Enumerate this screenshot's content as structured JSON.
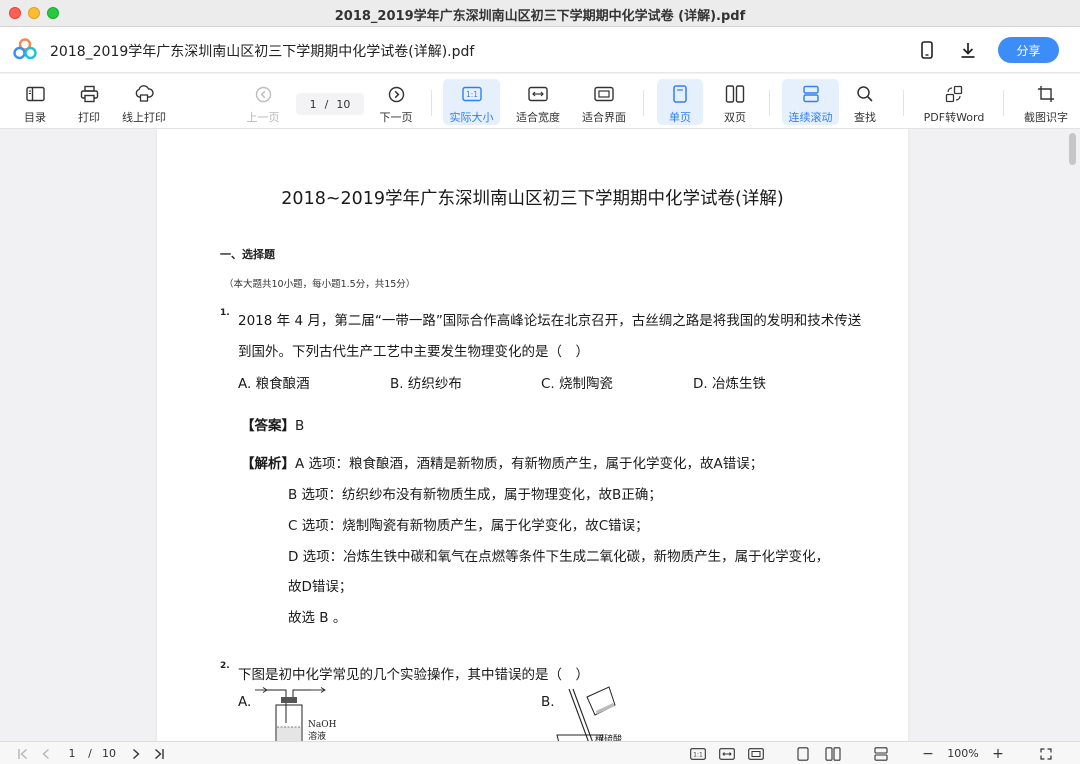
{
  "window": {
    "title": "2018_2019学年广东深圳南山区初三下学期期中化学试卷 (详解).pdf"
  },
  "header": {
    "doc_title": "2018_2019学年广东深圳南山区初三下学期期中化学试卷(详解).pdf",
    "share_label": "分享",
    "icons": [
      "app-logo-icon",
      "phone-icon",
      "download-icon"
    ]
  },
  "toolbar": {
    "toc": "目录",
    "print": "打印",
    "online_print": "线上打印",
    "prev_page": "上一页",
    "current_page": "1",
    "page_sep": "/",
    "total_pages": "10",
    "next_page": "下一页",
    "actual_size": "实际大小",
    "fit_width": "适合宽度",
    "fit_page": "适合界面",
    "single_page": "单页",
    "double_page": "双页",
    "continuous_scroll": "连续滚动",
    "search": "查找",
    "pdf_to_word": "PDF转Word",
    "screenshot_ocr": "截图识字",
    "actual_size_icon_text": "1:1",
    "accent_color": "#2f7ff2"
  },
  "document": {
    "heading": "2018~2019学年广东深圳南山区初三下学期期中化学试卷(详解)",
    "section_title": "一、选择题",
    "section_note": "（本大题共10小题，每小题1.5分，共15分）",
    "q1": {
      "number": "1.",
      "line1": "2018 年 4 月，第二届“一带一路”国际合作高峰论坛在北京召开，古丝绸之路是将我国的发明和技术传送",
      "line2": "到国外。下列古代生产工艺中主要发生物理变化的是（　）",
      "options": [
        "A. 粮食酿酒",
        "B. 纺织纱布",
        "C. 烧制陶瓷",
        "D. 冶炼生铁"
      ],
      "answer_label": "【答案】",
      "answer_value": "B",
      "analysis_label": "【解析】",
      "analysis": [
        "A 选项：粮食酿酒，酒精是新物质，有新物质产生，属于化学变化，故A错误；",
        "B 选项：纺织纱布没有新物质生成，属于物理变化，故B正确；",
        "C 选项：烧制陶瓷有新物质产生，属于化学变化，故C错误；",
        "D 选项：冶炼生铁中碳和氧气在点燃等条件下生成二氧化碳，新物质产生，属于化学变化，",
        "故D错误；",
        "故选 B 。"
      ]
    },
    "q2": {
      "number": "2.",
      "line1": "下图是初中化学常见的几个实验操作，其中错误的是（　）",
      "option_a": "A.",
      "option_b": "B.",
      "naoh_label": "NaOH",
      "solution_label": "溶液",
      "acid_label": "稀硫酸"
    }
  },
  "bottombar": {
    "current_page": "1",
    "page_sep": "/",
    "total_pages": "10",
    "zoom_minus": "−",
    "zoom": "100%",
    "zoom_plus": "+",
    "actual_size_icon_text": "1:1"
  }
}
